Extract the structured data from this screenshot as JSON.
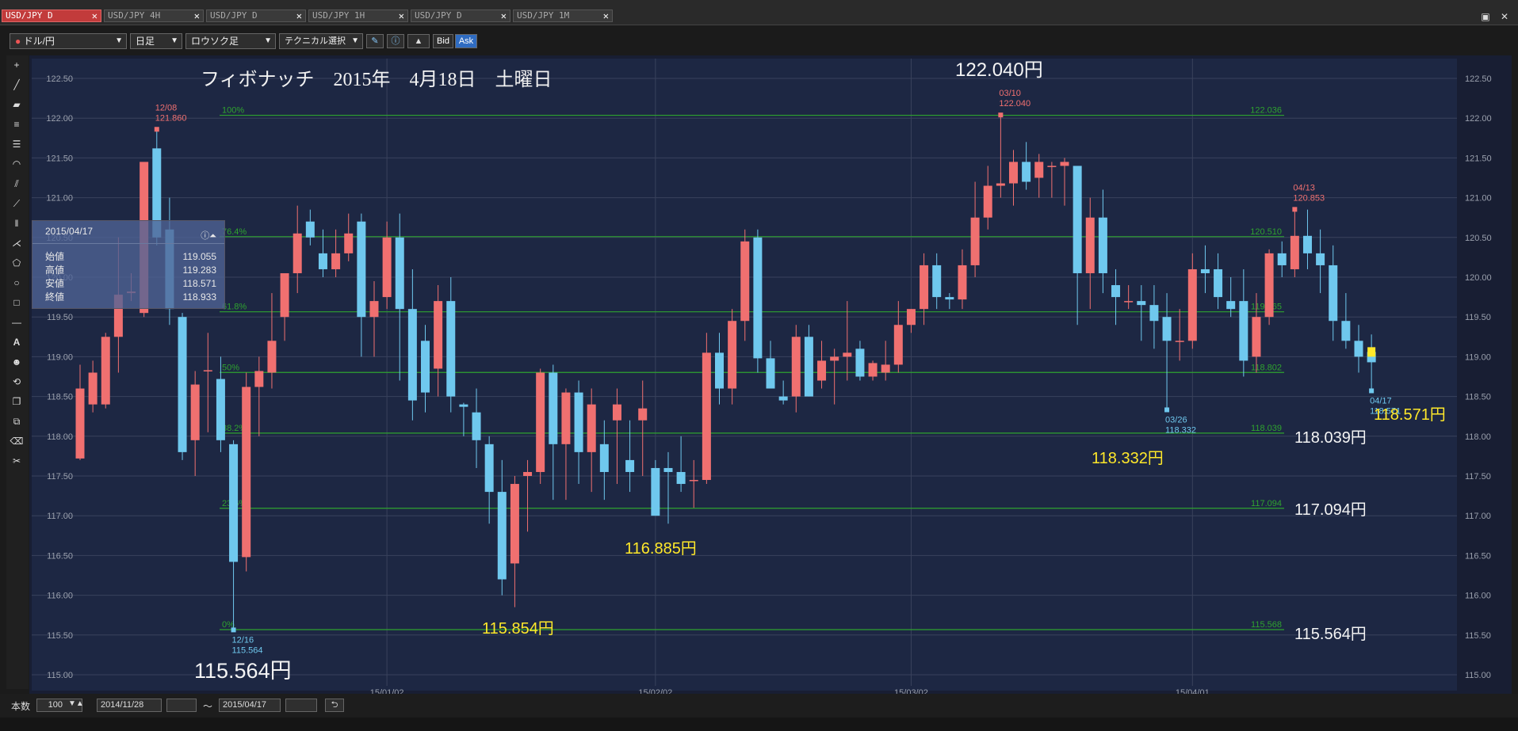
{
  "tabs": [
    {
      "label": "USD/JPY D",
      "active": true
    },
    {
      "label": "USD/JPY 4H",
      "active": false
    },
    {
      "label": "USD/JPY D",
      "active": false
    },
    {
      "label": "USD/JPY 1H",
      "active": false
    },
    {
      "label": "USD/JPY D",
      "active": false
    },
    {
      "label": "USD/JPY 1M",
      "active": false
    }
  ],
  "toolbar": {
    "pair": "ドル/円",
    "period": "日足",
    "chart_type": "ロウソク足",
    "technical": "テクニカル選択",
    "bid": "Bid",
    "ask": "Ask"
  },
  "bottom": {
    "count_label": "本数",
    "count_value": "100",
    "from_date": "2014/11/28",
    "tilde": "〜",
    "to_date": "2015/04/17"
  },
  "infobox": {
    "date": "2015/04/17",
    "rows": [
      {
        "label": "始値",
        "value": "119.055"
      },
      {
        "label": "高値",
        "value": "119.283"
      },
      {
        "label": "安値",
        "value": "118.571"
      },
      {
        "label": "終値",
        "value": "118.933"
      }
    ]
  },
  "colors": {
    "background": "#1c2540",
    "up": "#f07070",
    "down": "#6fc8ee",
    "fib": "#2fa32f",
    "annotation_yellow": "#ffe82a"
  },
  "chart_data": {
    "type": "candlestick",
    "title": "フィボナッチ　2015年　4月18日　土曜日",
    "ylim": [
      114.9,
      122.62
    ],
    "y_ticks": [
      "122.50",
      "122.00",
      "121.50",
      "121.00",
      "120.50",
      "120.00",
      "119.50",
      "119.00",
      "118.50",
      "118.00",
      "117.50",
      "117.00",
      "116.50",
      "116.00",
      "115.50",
      "115.00"
    ],
    "x_ticks": [
      {
        "label": "15/01/02",
        "index": 24
      },
      {
        "label": "15/02/02",
        "index": 45
      },
      {
        "label": "15/03/02",
        "index": 65
      },
      {
        "label": "15/04/01",
        "index": 87
      }
    ],
    "candles": [
      [
        117.72,
        118.9,
        117.7,
        118.6
      ],
      [
        118.4,
        118.95,
        118.3,
        118.8
      ],
      [
        118.4,
        119.3,
        118.35,
        119.25
      ],
      [
        119.25,
        120.5,
        118.8,
        119.78
      ],
      [
        119.8,
        120.05,
        119.7,
        119.82
      ],
      [
        119.55,
        121.4,
        119.5,
        121.45
      ],
      [
        121.62,
        121.86,
        120.4,
        120.5
      ],
      [
        120.6,
        121.0,
        119.4,
        119.6
      ],
      [
        119.5,
        119.55,
        117.7,
        117.8
      ],
      [
        117.95,
        118.82,
        117.5,
        118.65
      ],
      [
        118.82,
        119.3,
        118.05,
        118.83
      ],
      [
        118.72,
        119.0,
        117.8,
        117.95
      ],
      [
        117.9,
        117.95,
        115.56,
        116.42
      ],
      [
        116.48,
        118.8,
        116.3,
        118.62
      ],
      [
        118.62,
        119.0,
        118.0,
        118.82
      ],
      [
        118.8,
        119.8,
        118.6,
        119.2
      ],
      [
        119.5,
        120.0,
        119.2,
        120.05
      ],
      [
        120.05,
        120.9,
        119.8,
        120.55
      ],
      [
        120.7,
        120.85,
        120.4,
        120.5
      ],
      [
        120.3,
        120.6,
        120.0,
        120.1
      ],
      [
        120.1,
        120.6,
        120.0,
        120.3
      ],
      [
        120.3,
        120.8,
        120.2,
        120.55
      ],
      [
        120.7,
        120.8,
        119.0,
        119.5
      ],
      [
        119.5,
        119.95,
        119.0,
        119.7
      ],
      [
        119.75,
        120.7,
        119.6,
        120.5
      ],
      [
        120.5,
        120.8,
        118.7,
        119.6
      ],
      [
        119.6,
        120.1,
        118.2,
        118.45
      ],
      [
        119.2,
        119.4,
        118.3,
        118.55
      ],
      [
        118.85,
        119.9,
        118.5,
        119.7
      ],
      [
        119.7,
        120.0,
        118.3,
        118.5
      ],
      [
        118.4,
        118.42,
        118.0,
        118.37
      ],
      [
        118.3,
        118.6,
        117.6,
        117.95
      ],
      [
        117.9,
        118.0,
        116.9,
        117.3
      ],
      [
        117.3,
        117.7,
        116.0,
        116.2
      ],
      [
        116.4,
        117.5,
        115.85,
        117.4
      ],
      [
        117.5,
        117.7,
        116.8,
        117.55
      ],
      [
        117.55,
        118.85,
        117.4,
        118.8
      ],
      [
        118.8,
        118.9,
        117.2,
        117.9
      ],
      [
        117.9,
        118.6,
        117.2,
        118.55
      ],
      [
        118.55,
        118.7,
        117.4,
        117.8
      ],
      [
        117.8,
        118.6,
        117.3,
        118.4
      ],
      [
        117.9,
        118.2,
        117.2,
        117.55
      ],
      [
        118.2,
        118.6,
        117.4,
        118.4
      ],
      [
        117.7,
        118.2,
        117.3,
        117.55
      ],
      [
        118.2,
        118.7,
        117.5,
        118.35
      ],
      [
        117.6,
        117.7,
        117.0,
        117.0
      ],
      [
        117.6,
        117.8,
        116.9,
        117.55
      ],
      [
        117.55,
        118.0,
        117.3,
        117.4
      ],
      [
        117.45,
        117.7,
        117.1,
        117.45
      ],
      [
        117.45,
        119.3,
        117.4,
        119.05
      ],
      [
        119.05,
        119.3,
        118.4,
        118.6
      ],
      [
        118.6,
        119.6,
        118.4,
        119.45
      ],
      [
        119.45,
        120.6,
        119.2,
        120.45
      ],
      [
        120.5,
        120.6,
        118.8,
        118.98
      ],
      [
        118.98,
        119.2,
        118.7,
        118.6
      ],
      [
        118.5,
        118.7,
        118.4,
        118.45
      ],
      [
        118.5,
        119.4,
        118.3,
        119.25
      ],
      [
        119.25,
        119.4,
        118.5,
        118.5
      ],
      [
        118.7,
        119.2,
        118.6,
        118.95
      ],
      [
        118.95,
        119.1,
        118.4,
        119.0
      ],
      [
        119.0,
        119.7,
        118.7,
        119.05
      ],
      [
        119.1,
        119.2,
        118.7,
        118.75
      ],
      [
        118.75,
        118.95,
        118.7,
        118.92
      ],
      [
        118.8,
        119.2,
        118.7,
        118.9
      ],
      [
        118.9,
        119.7,
        118.8,
        119.4
      ],
      [
        119.4,
        119.6,
        119.3,
        119.6
      ],
      [
        119.6,
        120.3,
        119.4,
        120.15
      ],
      [
        120.15,
        120.3,
        119.6,
        119.75
      ],
      [
        119.75,
        119.8,
        119.6,
        119.72
      ],
      [
        119.72,
        120.35,
        119.6,
        120.15
      ],
      [
        120.15,
        121.2,
        120.0,
        120.75
      ],
      [
        120.75,
        121.4,
        120.6,
        121.15
      ],
      [
        121.15,
        122.04,
        121.0,
        121.18
      ],
      [
        121.18,
        121.6,
        120.9,
        121.45
      ],
      [
        121.45,
        121.7,
        121.1,
        121.2
      ],
      [
        121.25,
        121.55,
        121.0,
        121.45
      ],
      [
        121.4,
        121.45,
        121.0,
        121.4
      ],
      [
        121.4,
        121.5,
        120.9,
        121.45
      ],
      [
        121.4,
        121.4,
        119.4,
        120.05
      ],
      [
        120.05,
        121.0,
        119.6,
        120.75
      ],
      [
        120.75,
        121.1,
        119.8,
        120.05
      ],
      [
        119.9,
        120.1,
        119.4,
        119.75
      ],
      [
        119.7,
        119.9,
        119.6,
        119.7
      ],
      [
        119.7,
        119.9,
        119.2,
        119.65
      ],
      [
        119.65,
        119.9,
        119.1,
        119.45
      ],
      [
        119.5,
        119.8,
        118.33,
        119.2
      ],
      [
        119.2,
        119.6,
        118.95,
        119.2
      ],
      [
        119.2,
        120.3,
        119.1,
        120.1
      ],
      [
        120.1,
        120.4,
        119.8,
        120.05
      ],
      [
        120.1,
        120.3,
        119.6,
        119.75
      ],
      [
        119.7,
        120.0,
        119.5,
        119.6
      ],
      [
        119.7,
        120.1,
        118.75,
        118.95
      ],
      [
        119.0,
        119.8,
        118.8,
        119.5
      ],
      [
        119.5,
        120.35,
        119.4,
        120.3
      ],
      [
        120.3,
        120.45,
        120.0,
        120.15
      ],
      [
        120.1,
        120.85,
        120.0,
        120.52
      ],
      [
        120.52,
        120.85,
        120.1,
        120.3
      ],
      [
        120.3,
        120.6,
        119.8,
        120.15
      ],
      [
        120.15,
        120.4,
        119.2,
        119.45
      ],
      [
        119.45,
        119.8,
        119.1,
        119.2
      ],
      [
        119.2,
        119.4,
        118.8,
        119.0
      ],
      [
        119.06,
        119.28,
        118.57,
        118.93
      ]
    ],
    "fib_levels": [
      {
        "pct": "100%",
        "value": 122.036,
        "label": "122.036"
      },
      {
        "pct": "76.4%",
        "value": 120.51,
        "label": "120.510"
      },
      {
        "pct": "61.8%",
        "value": 119.565,
        "label": "119.565"
      },
      {
        "pct": "50%",
        "value": 118.802,
        "label": "118.802"
      },
      {
        "pct": "38.2%",
        "value": 118.039,
        "label": "118.039"
      },
      {
        "pct": "23.6%",
        "value": 117.094,
        "label": "117.094"
      },
      {
        "pct": "0%",
        "value": 115.568,
        "label": "115.568"
      }
    ],
    "markers": [
      {
        "date": "12/08",
        "price": "121.860",
        "index": 6,
        "value": 121.86,
        "type": "high"
      },
      {
        "date": "12/16",
        "price": "115.564",
        "index": 12,
        "value": 115.564,
        "type": "low"
      },
      {
        "date": "03/10",
        "price": "122.040",
        "index": 72,
        "value": 122.04,
        "type": "high"
      },
      {
        "date": "03/26",
        "price": "118.332",
        "index": 85,
        "value": 118.332,
        "type": "low"
      },
      {
        "date": "04/13",
        "price": "120.853",
        "index": 95,
        "value": 120.853,
        "type": "high"
      },
      {
        "date": "04/17",
        "price": "118.571",
        "index": 101,
        "value": 118.571,
        "type": "low"
      }
    ],
    "annotations": [
      {
        "text": "122.040円",
        "color": "white"
      },
      {
        "text": "115.564円",
        "color": "white"
      },
      {
        "text": "115.854円",
        "color": "yellow"
      },
      {
        "text": "116.885円",
        "color": "yellow"
      },
      {
        "text": "118.332円",
        "color": "yellow"
      },
      {
        "text": "118.571円",
        "color": "yellow"
      },
      {
        "text": "118.039円",
        "color": "white"
      },
      {
        "text": "117.094円",
        "color": "white"
      },
      {
        "text": "115.564円",
        "color": "white"
      }
    ]
  }
}
